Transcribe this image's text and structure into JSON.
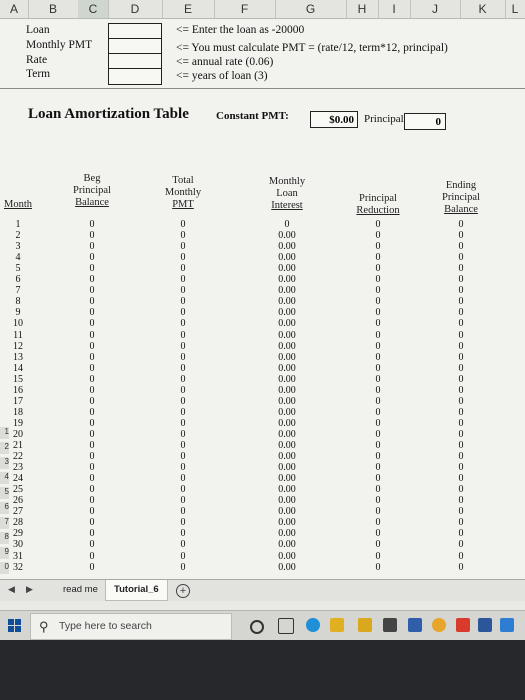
{
  "columns": [
    "A",
    "B",
    "C",
    "D",
    "E",
    "F",
    "G",
    "H",
    "I",
    "J",
    "K",
    "L"
  ],
  "inputs": {
    "labels": [
      "Loan",
      "Monthly PMT",
      "Rate",
      "Term"
    ],
    "notes": [
      "<= Enter the loan as -20000",
      "<= You must calculate  PMT = (rate/12, term*12, principal)",
      "<= annual rate (0.06)",
      "<= years of loan (3)"
    ]
  },
  "table": {
    "title": "Loan Amortization Table",
    "constant_pmt_label": "Constant PMT:",
    "constant_pmt_value": "$0.00",
    "principal_label": "Principal",
    "principal_value": "0",
    "headers": {
      "month": "Month",
      "beg": [
        "Beg",
        "Principal",
        "Balance"
      ],
      "total": [
        "Total",
        "Monthly",
        "PMT"
      ],
      "interest": [
        "Monthly",
        "Loan",
        "Interest"
      ],
      "reduction": [
        "Principal",
        "Reduction"
      ],
      "ending": [
        "Ending",
        "Principal",
        "Balance"
      ]
    },
    "months": [
      "1",
      "2",
      "3",
      "4",
      "5",
      "6",
      "7",
      "8",
      "9",
      "10",
      "11",
      "12",
      "13",
      "14",
      "15",
      "16",
      "17",
      "18",
      "19",
      "20",
      "21",
      "22",
      "23",
      "24",
      "25",
      "26",
      "27",
      "28",
      "29",
      "30",
      "31",
      "32"
    ],
    "beg_balance": [
      "0",
      "0",
      "0",
      "0",
      "0",
      "0",
      "0",
      "0",
      "0",
      "0",
      "0",
      "0",
      "0",
      "0",
      "0",
      "0",
      "0",
      "0",
      "0",
      "0",
      "0",
      "0",
      "0",
      "0",
      "0",
      "0",
      "0",
      "0",
      "0",
      "0",
      "0",
      "0"
    ],
    "total_pmt": [
      "0",
      "0",
      "0",
      "0",
      "0",
      "0",
      "0",
      "0",
      "0",
      "0",
      "0",
      "0",
      "0",
      "0",
      "0",
      "0",
      "0",
      "0",
      "0",
      "0",
      "0",
      "0",
      "0",
      "0",
      "0",
      "0",
      "0",
      "0",
      "0",
      "0",
      "0",
      "0"
    ],
    "interest": [
      "0",
      "0.00",
      "0.00",
      "0.00",
      "0.00",
      "0.00",
      "0.00",
      "0.00",
      "0.00",
      "0.00",
      "0.00",
      "0.00",
      "0.00",
      "0.00",
      "0.00",
      "0.00",
      "0.00",
      "0.00",
      "0.00",
      "0.00",
      "0.00",
      "0.00",
      "0.00",
      "0.00",
      "0.00",
      "0.00",
      "0.00",
      "0.00",
      "0.00",
      "0.00",
      "0.00",
      "0.00"
    ],
    "reduction": [
      "0",
      "0",
      "0",
      "0",
      "0",
      "0",
      "0",
      "0",
      "0",
      "0",
      "0",
      "0",
      "0",
      "0",
      "0",
      "0",
      "0",
      "0",
      "0",
      "0",
      "0",
      "0",
      "0",
      "0",
      "0",
      "0",
      "0",
      "0",
      "0",
      "0",
      "0",
      "0"
    ],
    "ending": [
      "0",
      "0",
      "0",
      "0",
      "0",
      "0",
      "0",
      "0",
      "0",
      "0",
      "0",
      "0",
      "0",
      "0",
      "0",
      "0",
      "0",
      "0",
      "0",
      "0",
      "0",
      "0",
      "0",
      "0",
      "0",
      "0",
      "0",
      "0",
      "0",
      "0",
      "0",
      "0"
    ]
  },
  "sheet_tabs": [
    "read me",
    "Tutorial_6"
  ],
  "active_tab": "Tutorial_6",
  "taskbar": {
    "search_placeholder": "Type here to search"
  },
  "row_numbers": [
    "1",
    "2",
    "3",
    "4",
    "5",
    "6",
    "7",
    "8",
    "9",
    "0"
  ]
}
